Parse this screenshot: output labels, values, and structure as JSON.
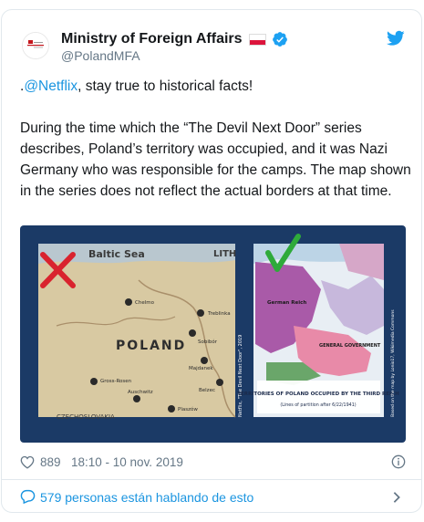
{
  "tweet": {
    "author_name": "Ministry of Foreign Affairs",
    "handle": "@PolandMFA",
    "mention": "@Netflix",
    "text_intro_prefix": ".",
    "text_intro_suffix": ", stay true to historical facts!",
    "text_body": "During the time which the “The Devil Next Door” series describes, Poland’s territory was occupied, and it was Nazi Germany who was responsible for the camps. The map shown in the series does not reflect the actual borders at that time.",
    "likes": "889",
    "timestamp": "18:10 - 10 nov. 2019"
  },
  "media": {
    "left_map": {
      "sea_label": "Baltic Sea",
      "country_top": "LITH",
      "country_label": "POLAND",
      "places": [
        "Chelmo",
        "Treblinka",
        "Sobibór",
        "Gross-Rosen",
        "Majdanek",
        "Auschwitz",
        "Belzec",
        "Plaszów"
      ],
      "bottom_label": "CZECHOSLOVAKIA",
      "credit": "Netflix, \"The Devil Next Door\", 2019"
    },
    "right_map": {
      "region_reich": "German Reich",
      "region_gg": "GENERAL GOVERNMENT",
      "caption_title": "TERRITORIES OF POLAND OCCUPIED BY THE THIRD REICH",
      "caption_sub": "(Lines of partition after 6/22/1941)",
      "credit": "Based on the map by Lonio17, Wikimedia Commons"
    }
  },
  "footer": {
    "conversation": "579 personas están hablando de esto"
  },
  "colors": {
    "link": "#1b95e0",
    "flag_red": "#dc143c",
    "media_bg": "#1b3a66"
  }
}
